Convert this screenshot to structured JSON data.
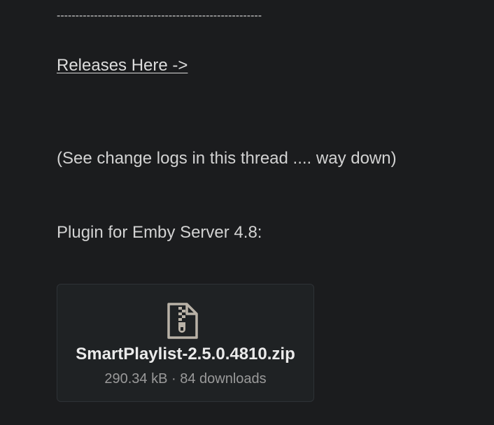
{
  "post": {
    "divider": "-------------------------------------------------------",
    "releases_link": "Releases Here ->",
    "changelog_note": "(See change logs in this thread .... way down)",
    "plugin_label": "Plugin for Emby Server 4.8:"
  },
  "attachment": {
    "icon": "zip-file-icon",
    "file_name": "SmartPlaylist-2.5.0.4810.zip",
    "meta": "290.34 kB · 84 downloads"
  },
  "colors": {
    "background": "#1b1c1e",
    "card_background": "#1f2224",
    "card_border": "#2e3236",
    "icon_color": "#b9b2a7",
    "meta_text": "#9a9a9a"
  }
}
